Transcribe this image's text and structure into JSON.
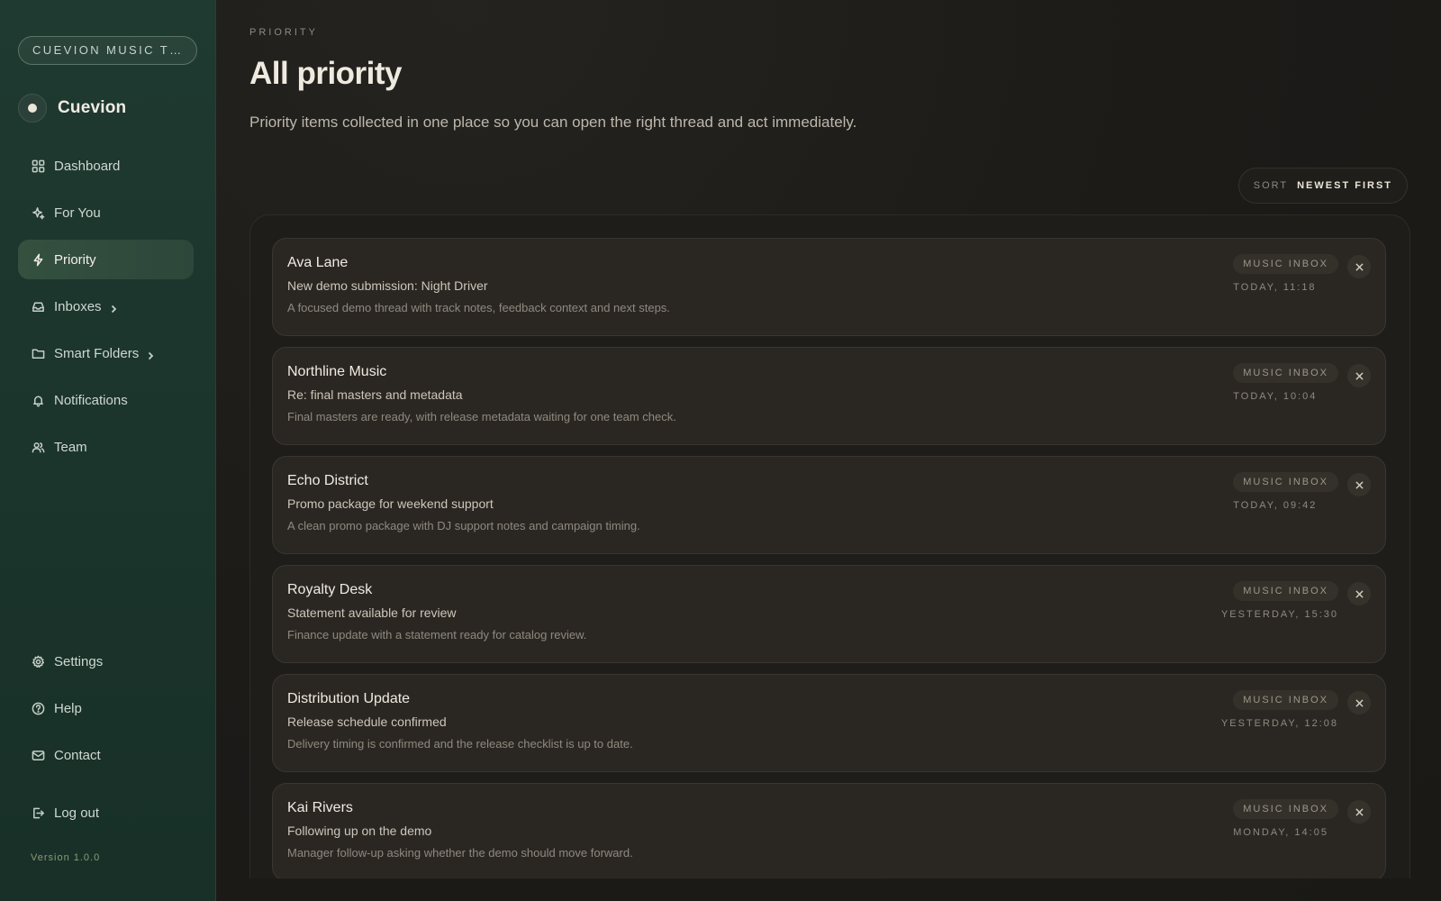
{
  "sidebar": {
    "workspace": "CUEVION MUSIC TEAM",
    "brand": "Cuevion",
    "nav": [
      {
        "label": "Dashboard",
        "icon": "dashboard-icon"
      },
      {
        "label": "For You",
        "icon": "sparkle-icon"
      },
      {
        "label": "Priority",
        "icon": "lightning-icon",
        "active": true
      },
      {
        "label": "Inboxes",
        "icon": "inbox-icon",
        "has_submenu": true
      },
      {
        "label": "Smart Folders",
        "icon": "folder-icon",
        "has_submenu": true
      },
      {
        "label": "Notifications",
        "icon": "bell-icon"
      },
      {
        "label": "Team",
        "icon": "team-icon"
      }
    ],
    "bottom_nav": [
      {
        "label": "Settings",
        "icon": "gear-icon"
      },
      {
        "label": "Help",
        "icon": "help-icon"
      },
      {
        "label": "Contact",
        "icon": "mail-icon"
      }
    ],
    "logout": "Log out",
    "version": "Version 1.0.0"
  },
  "header": {
    "eyebrow": "PRIORITY",
    "title": "All priority",
    "description": "Priority items collected in one place so you can open the right thread and act immediately."
  },
  "sort": {
    "label": "SORT",
    "value": "NEWEST FIRST"
  },
  "items": [
    {
      "sender": "Ava Lane",
      "subject": "New demo submission: Night Driver",
      "preview": "A focused demo thread with track notes, feedback context and next steps.",
      "tag": "MUSIC INBOX",
      "time": "TODAY, 11:18"
    },
    {
      "sender": "Northline Music",
      "subject": "Re: final masters and metadata",
      "preview": "Final masters are ready, with release metadata waiting for one team check.",
      "tag": "MUSIC INBOX",
      "time": "TODAY, 10:04"
    },
    {
      "sender": "Echo District",
      "subject": "Promo package for weekend support",
      "preview": "A clean promo package with DJ support notes and campaign timing.",
      "tag": "MUSIC INBOX",
      "time": "TODAY, 09:42"
    },
    {
      "sender": "Royalty Desk",
      "subject": "Statement available for review",
      "preview": "Finance update with a statement ready for catalog review.",
      "tag": "MUSIC INBOX",
      "time": "YESTERDAY, 15:30"
    },
    {
      "sender": "Distribution Update",
      "subject": "Release schedule confirmed",
      "preview": "Delivery timing is confirmed and the release checklist is up to date.",
      "tag": "MUSIC INBOX",
      "time": "YESTERDAY, 12:08"
    },
    {
      "sender": "Kai Rivers",
      "subject": "Following up on the demo",
      "preview": "Manager follow-up asking whether the demo should move forward.",
      "tag": "MUSIC INBOX",
      "time": "MONDAY, 14:05"
    }
  ]
}
